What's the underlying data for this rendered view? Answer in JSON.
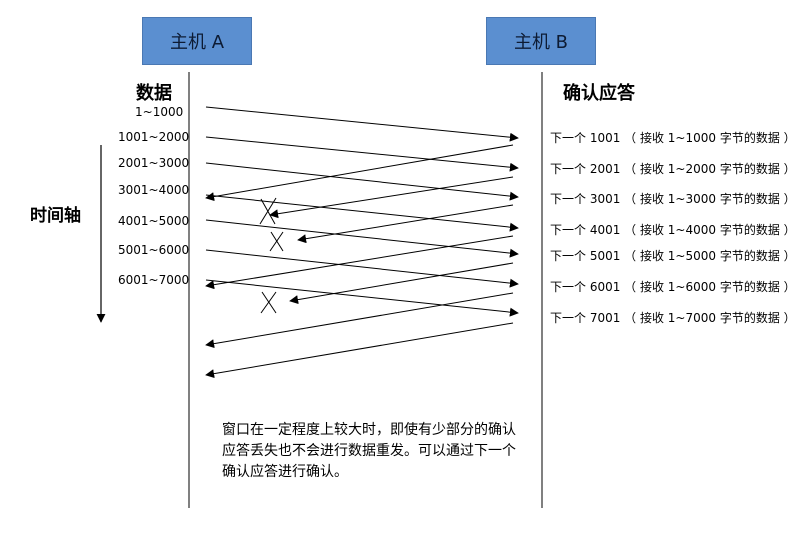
{
  "hosts": {
    "a": "主机 A",
    "b": "主机 B"
  },
  "headings": {
    "data": "数据",
    "ack": "确认应答"
  },
  "axis_label": "时间轴",
  "segments": [
    "1~1000",
    "1001~2000",
    "2001~3000",
    "3001~4000",
    "4001~5000",
    "5001~6000",
    "6001~7000"
  ],
  "acks": [
    "下一个 1001 （ 接收 1~1000 字节的数据 ）",
    "下一个 2001 （ 接收 1~2000 字节的数据 ）",
    "下一个 3001 （ 接收 1~3000 字节的数据 ）",
    "下一个 4001 （ 接收 1~4000 字节的数据 ）",
    "下一个 5001 （ 接收 1~5000 字节的数据 ）",
    "下一个 6001 （ 接收 1~6000 字节的数据 ）",
    "下一个 7001 （ 接收 1~7000 字节的数据 ）"
  ],
  "note": "窗口在一定程度上较大时，即使有少部分的确认应答丢失也不会进行数据重发。可以通过下一个确认应答进行确认。",
  "lost_ack_count": 3
}
